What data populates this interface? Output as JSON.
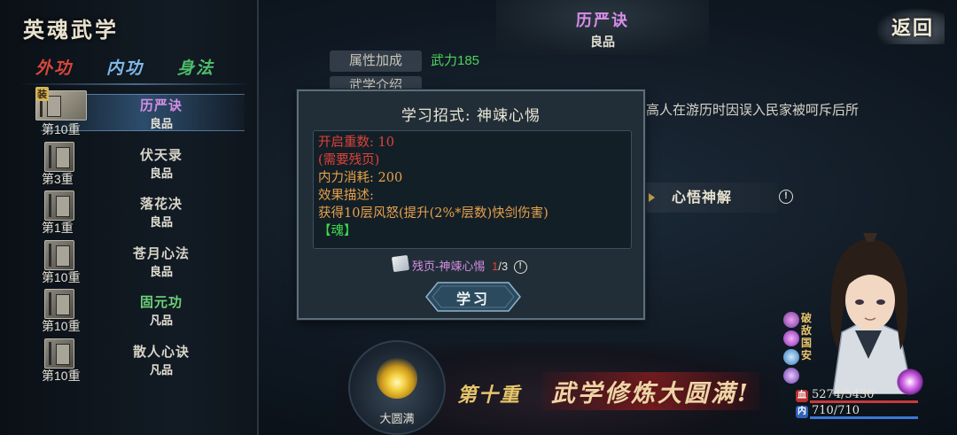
{
  "sidebar": {
    "title": "英魂武学",
    "tabs": [
      {
        "label": "外功",
        "color": "#d8473a"
      },
      {
        "label": "内功",
        "color": "#7fb7e8"
      },
      {
        "label": "身法",
        "color": "#4fbf6a"
      }
    ],
    "selected_tab": "内功",
    "items": [
      {
        "name": "历严诀",
        "grade": "良品",
        "level": "第10重",
        "tag": "装",
        "selected": true
      },
      {
        "name": "伏天录",
        "grade": "良品",
        "level": "第3重"
      },
      {
        "name": "落花决",
        "grade": "良品",
        "level": "第1重"
      },
      {
        "name": "苍月心法",
        "grade": "良品",
        "level": "第10重"
      },
      {
        "name": "固元功",
        "grade": "凡品",
        "level": "第10重"
      },
      {
        "name": "散人心诀",
        "grade": "凡品",
        "level": "第10重"
      }
    ]
  },
  "header": {
    "title": "历严诀",
    "grade": "良品",
    "back_label": "返回"
  },
  "details": {
    "attr_label": "属性加成",
    "attr_value": "武力185",
    "intro_label": "武学介绍",
    "intro_text": "高人在游历时因误入民家被呵斥后所",
    "insight_label": "心悟神解",
    "insight_info": "!"
  },
  "popup": {
    "title": "学习招式: 神竦心惕",
    "lines": {
      "unlock_level": "开启重数: 10",
      "needs_fragment": "(需要残页)",
      "internal_cost": "内力消耗: 200",
      "effect_label": "效果描述:",
      "effect_text": "获得10层风怒(提升(2%*层数)快剑伤害)",
      "soul_tag": "【魂】"
    },
    "fragment": {
      "label": "残页-神竦心惕",
      "owned": "1",
      "required": "/3",
      "info": "!"
    },
    "learn_label": "学习"
  },
  "bottom": {
    "complete_label": "大圆满",
    "tenth_layer": "第十重",
    "cultivation_complete": "武学修炼大圆满!"
  },
  "character": {
    "name": "破敌国安",
    "hp_icon": "血",
    "mp_icon": "内",
    "hp": "5274/5430",
    "mp": "710/710"
  },
  "colors": {
    "selected_skill": "#d68ee6",
    "attr_value": "#4fd25a",
    "warning_red": "#e0423a",
    "effect_orange": "#e8a24a",
    "soul_green": "#3ede4c"
  }
}
